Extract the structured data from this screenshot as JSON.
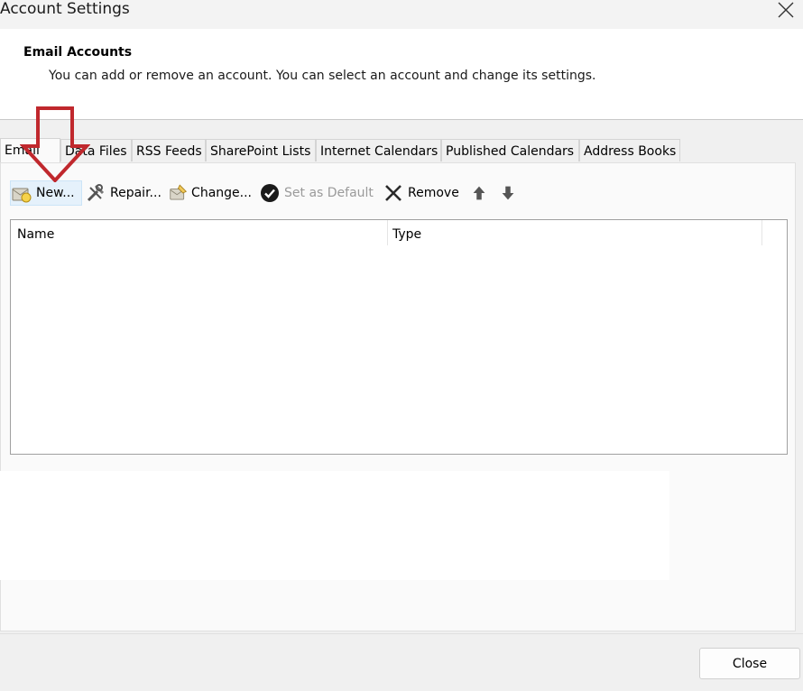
{
  "window": {
    "title": "Account Settings",
    "close_icon": "close-icon"
  },
  "header": {
    "title": "Email Accounts",
    "description": "You can add or remove an account. You can select an account and change its settings."
  },
  "tabs": [
    {
      "label": "Email",
      "active": true
    },
    {
      "label": "Data Files"
    },
    {
      "label": "RSS Feeds"
    },
    {
      "label": "SharePoint Lists"
    },
    {
      "label": "Internet Calendars"
    },
    {
      "label": "Published Calendars"
    },
    {
      "label": "Address Books"
    }
  ],
  "toolbar": {
    "new": {
      "label": "New...",
      "icon": "new-account-icon"
    },
    "repair": {
      "label": "Repair...",
      "icon": "repair-tools-icon"
    },
    "change": {
      "label": "Change...",
      "icon": "change-account-icon"
    },
    "set_default": {
      "label": "Set as Default",
      "icon": "checkmark-circle-icon",
      "disabled": true
    },
    "remove": {
      "label": "Remove",
      "icon": "remove-x-icon"
    },
    "move_up": {
      "icon": "arrow-up-icon"
    },
    "move_down": {
      "icon": "arrow-down-icon"
    }
  },
  "accounts_list": {
    "columns": [
      "Name",
      "Type"
    ],
    "rows": []
  },
  "footer": {
    "close_label": "Close"
  },
  "annotation": {
    "icon": "red-down-arrow-icon",
    "color": "#c0282d"
  },
  "colors": {
    "annotation_red": "#c0282d",
    "selected_bg": "#e5f1fb"
  }
}
